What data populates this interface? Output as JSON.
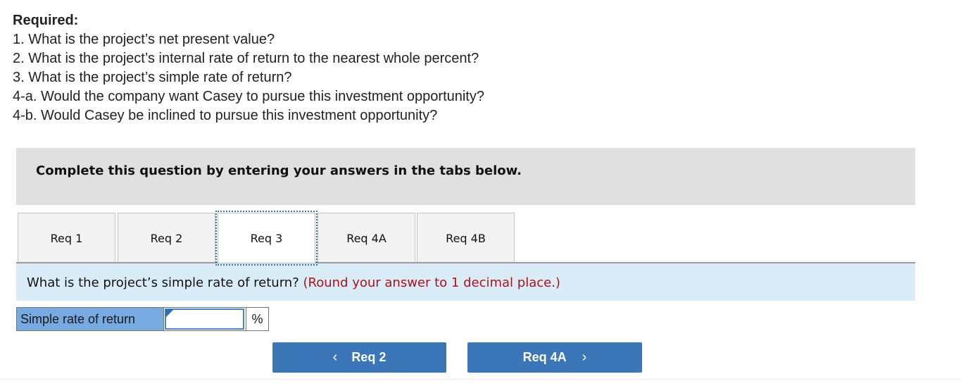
{
  "required": {
    "title": "Required:",
    "items": [
      "1. What is the project’s net present value?",
      "2. What is the project’s internal rate of return to the nearest whole percent?",
      "3. What is the project’s simple rate of return?",
      "4-a. Would the company want Casey to pursue this investment opportunity?",
      "4-b. Would Casey be inclined to pursue this investment opportunity?"
    ]
  },
  "instructions": "Complete this question by entering your answers in the tabs below.",
  "tabs": [
    {
      "label": "Req 1",
      "active": false
    },
    {
      "label": "Req 2",
      "active": false
    },
    {
      "label": "Req 3",
      "active": true
    },
    {
      "label": "Req 4A",
      "active": false
    },
    {
      "label": "Req 4B",
      "active": false
    }
  ],
  "question": {
    "text": "What is the project’s simple rate of return?",
    "hint": "(Round your answer to 1 decimal place.)"
  },
  "answer": {
    "label": "Simple rate of return",
    "value": "",
    "unit": "%"
  },
  "navigation": {
    "prev_label": "Req 2",
    "prev_icon": "‹",
    "next_label": "Req 4A",
    "next_icon": "›"
  },
  "colors": {
    "accent_blue": "#3a76b8",
    "hint_red": "#b0101a",
    "question_bg": "#dbecf9",
    "label_bg": "#76aae0",
    "instructions_bg": "#e0e0e0"
  }
}
